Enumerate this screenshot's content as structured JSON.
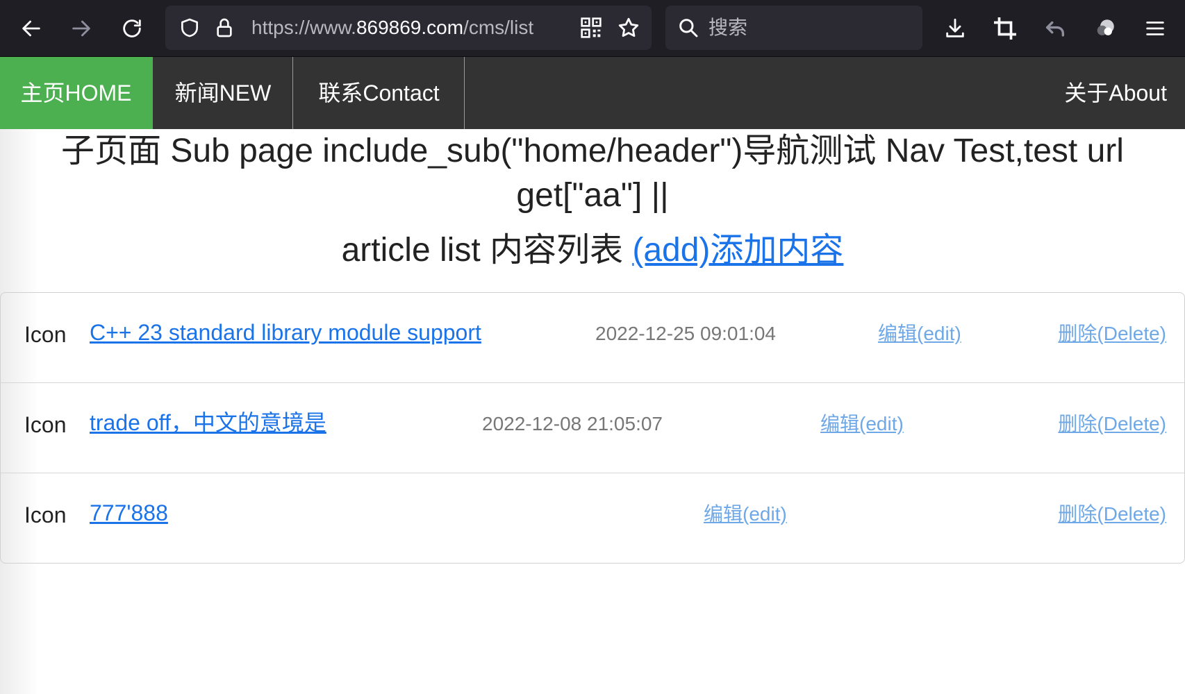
{
  "browser": {
    "url_prefix": "https://www.",
    "url_host": "869869.com",
    "url_path": "/cms/list",
    "search_placeholder": "搜索"
  },
  "nav": {
    "items": [
      {
        "label": "主页HOME"
      },
      {
        "label": "新闻NEW"
      },
      {
        "label": "联系Contact"
      }
    ],
    "about": "关于About",
    "active_color": "#4caf50",
    "bar_color": "#333333"
  },
  "page": {
    "title": "子页面 Sub page include_sub(\"home/header\")导航测试 Nav Test,test url get[\"aa\"] ||",
    "list_heading": "article list 内容列表 ",
    "add_link": "(add)添加内容"
  },
  "articles": [
    {
      "icon": "Icon",
      "title": "C++ 23 standard library module support",
      "date": "2022-12-25 09:01:04",
      "edit": "编辑(edit)",
      "delete": "删除(Delete)"
    },
    {
      "icon": "Icon",
      "title": "trade off，中文的意境是",
      "date": "2022-12-08 21:05:07",
      "edit": "编辑(edit)",
      "delete": "删除(Delete)"
    },
    {
      "icon": "Icon",
      "title": "777'888",
      "date": "",
      "edit": "编辑(edit)",
      "delete": "删除(Delete)"
    }
  ],
  "colors": {
    "link": "#1a73e8",
    "link_muted": "#6fa8e6",
    "toolbar": "#1f1e25"
  }
}
